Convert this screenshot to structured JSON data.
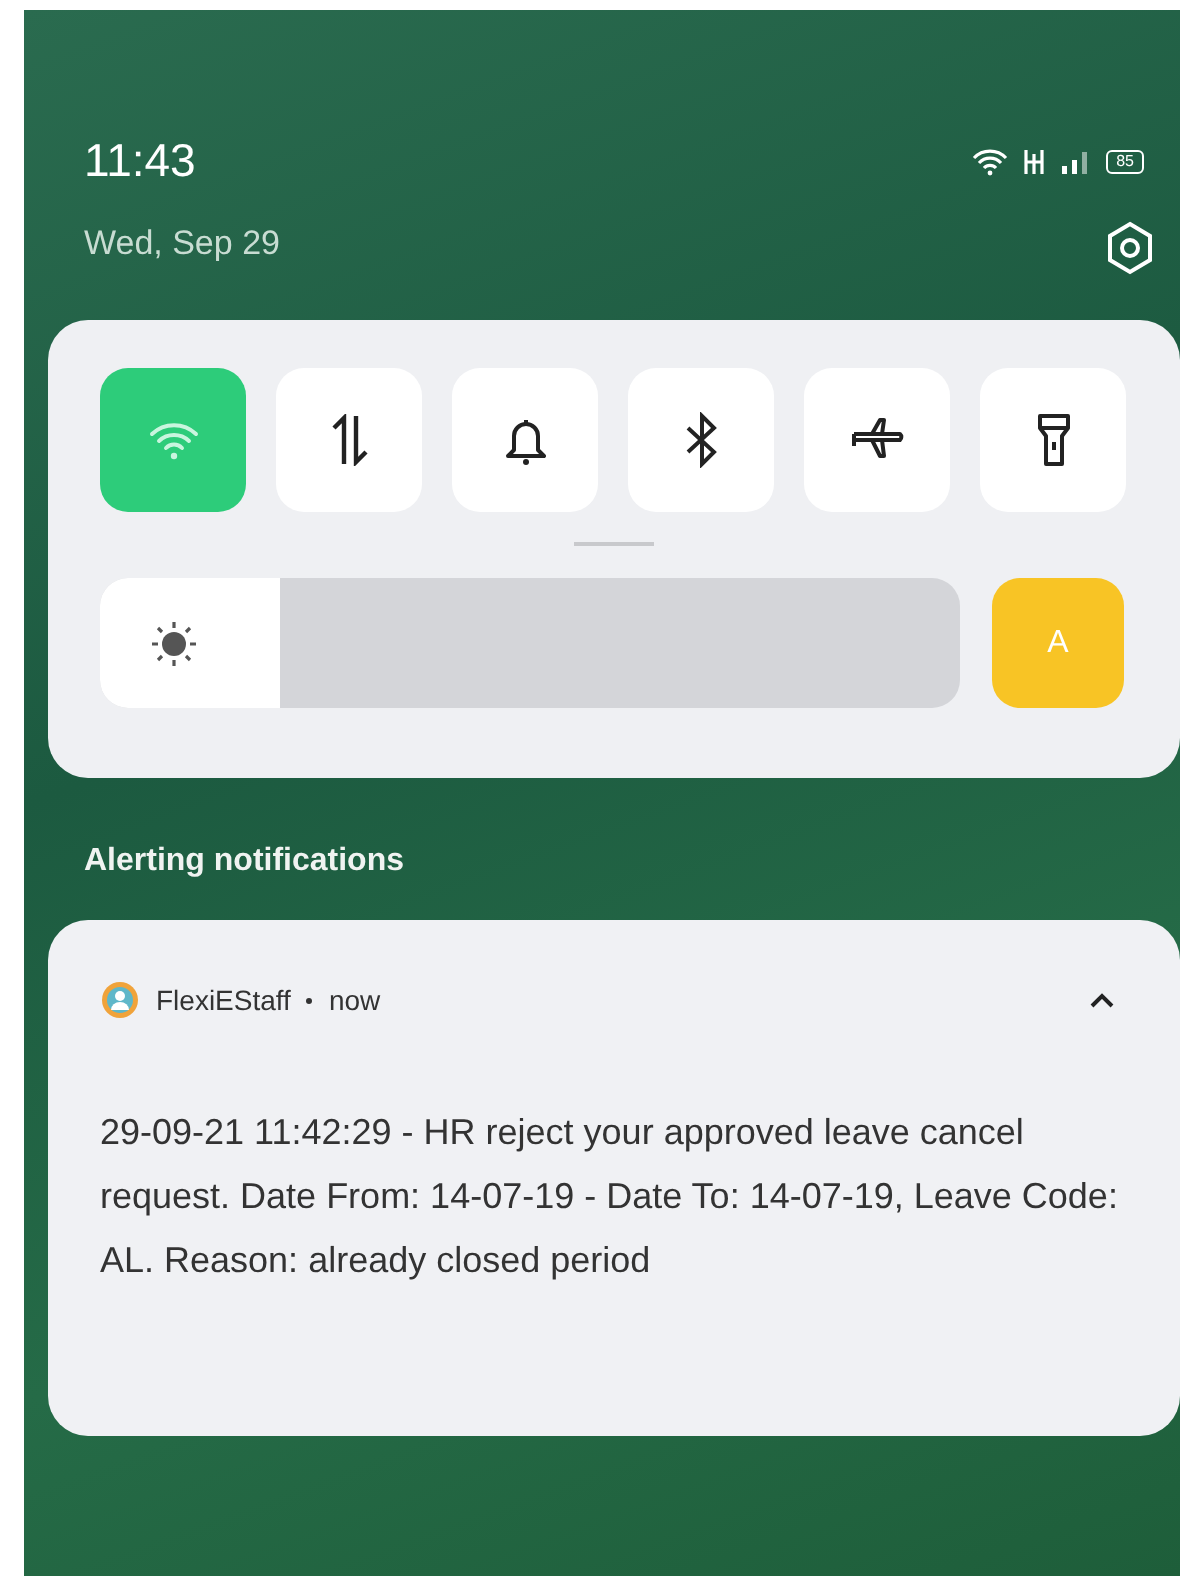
{
  "status_bar": {
    "time": "11:43",
    "date": "Wed, Sep 29",
    "battery": "85"
  },
  "quick_settings": {
    "tiles": [
      {
        "kind": "wifi",
        "on": true
      },
      {
        "kind": "data",
        "on": false
      },
      {
        "kind": "sound",
        "on": false
      },
      {
        "kind": "bluetooth",
        "on": false
      },
      {
        "kind": "airplane",
        "on": false
      },
      {
        "kind": "flashlight",
        "on": false
      }
    ],
    "brightness": {
      "level": 0.21,
      "auto_label": "A",
      "auto_on": true
    }
  },
  "section_title": "Alerting notifications",
  "notification": {
    "app": "FlexiEStaff",
    "time": "now",
    "expanded": true,
    "body": "29-09-21 11:42:29 - HR reject your approved leave cancel request. Date From: 14-07-19 - Date To: 14-07-19, Leave Code: AL. Reason: already closed period"
  }
}
